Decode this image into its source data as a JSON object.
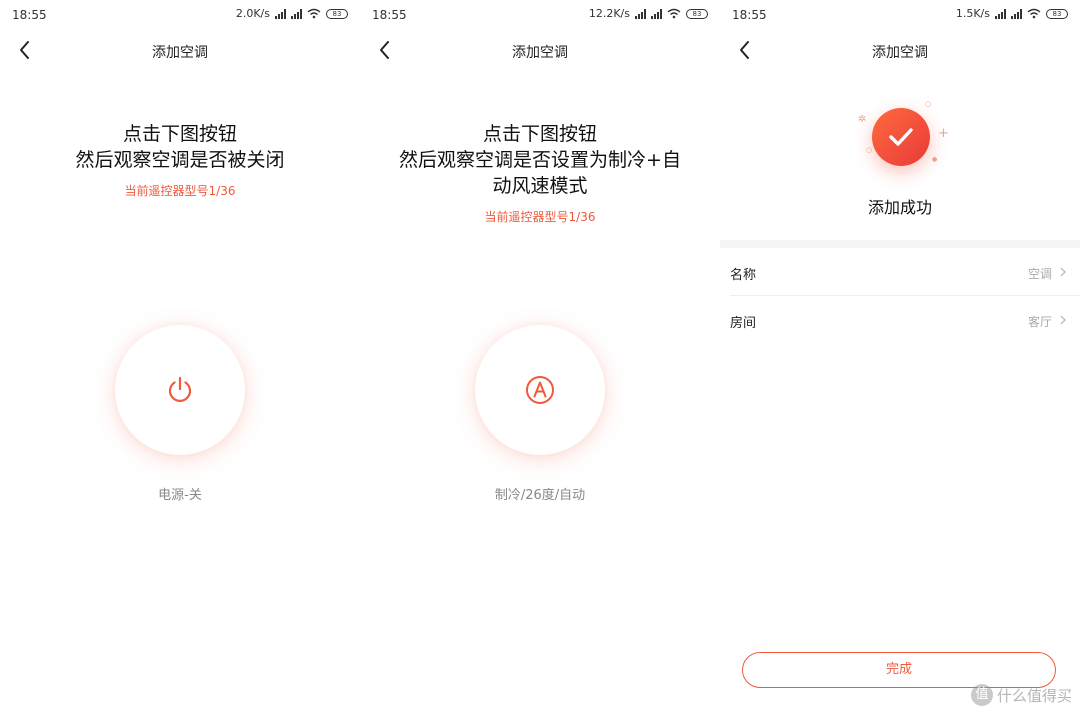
{
  "screens": [
    {
      "status": {
        "time": "18:55",
        "speed": "2.0K/s",
        "battery": "83"
      },
      "nav_title": "添加空调",
      "instruction": [
        "点击下图按钮",
        "然后观察空调是否被关闭"
      ],
      "model": "当前遥控器型号1/36",
      "button_icon": "power-icon",
      "button_label": "电源-关"
    },
    {
      "status": {
        "time": "18:55",
        "speed": "12.2K/s",
        "battery": "83"
      },
      "nav_title": "添加空调",
      "instruction": [
        "点击下图按钮",
        "然后观察空调是否设置为制冷+自",
        "动风速模式"
      ],
      "model": "当前遥控器型号1/36",
      "button_icon": "auto-mode-icon",
      "button_label": "制冷/26度/自动"
    },
    {
      "status": {
        "time": "18:55",
        "speed": "1.5K/s",
        "battery": "83"
      },
      "nav_title": "添加空调",
      "success_text": "添加成功",
      "rows": [
        {
          "label": "名称",
          "value": "空调"
        },
        {
          "label": "房间",
          "value": "客厅"
        }
      ],
      "done_label": "完成"
    }
  ],
  "watermark": {
    "logo": "值",
    "text": "什么值得买"
  },
  "colors": {
    "accent": "#f05a3c",
    "gradient_start": "#ff6a3d",
    "gradient_end": "#e93a3a"
  }
}
